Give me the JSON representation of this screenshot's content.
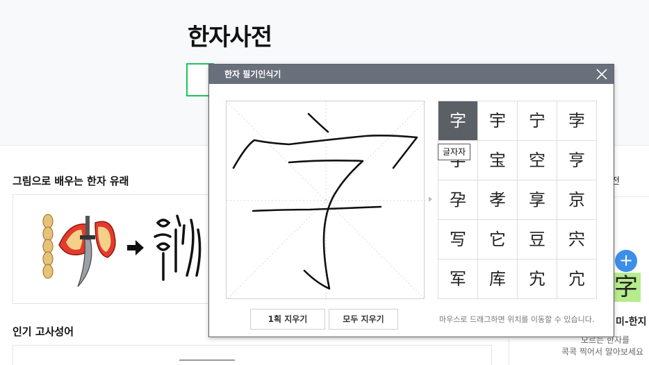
{
  "page": {
    "title": "한자사전",
    "origin_section_title": "그림으로 배우는 한자 유래",
    "idiom_section_title": "인기 고사성어",
    "right_tab_fragment": "전",
    "right_hanja": "字",
    "right_plus": "+",
    "right_title_fragment": "미-한지",
    "right_desc_line1": "모르는 한자를",
    "right_desc_line2": "콕콕 찍어서 알아보세요"
  },
  "dialog": {
    "title": "한자 필기인식기",
    "close_icon": "close-icon",
    "results": [
      "字",
      "宇",
      "宁",
      "孛",
      "字",
      "宝",
      "空",
      "亨",
      "孕",
      "孝",
      "享",
      "京",
      "写",
      "它",
      "豆",
      "宍",
      "军",
      "库",
      "宄",
      "宂"
    ],
    "selected_index": 0,
    "tooltip": "글자자",
    "undo_label": "1획 지우기",
    "clear_label": "모두 지우기",
    "hint": "마우스로 드래그하면 위치를 이동할 수 있습니다."
  }
}
